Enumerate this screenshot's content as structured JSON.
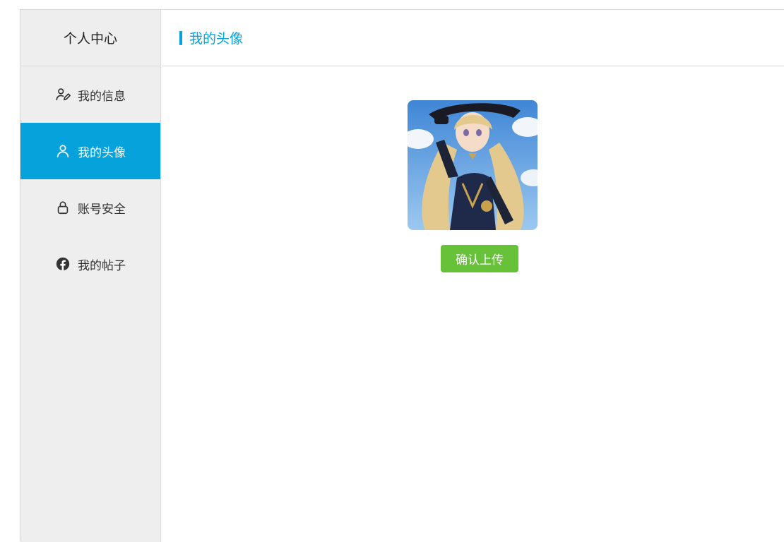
{
  "sidebar": {
    "title": "个人中心",
    "items": [
      {
        "label": "我的信息",
        "icon": "user-edit-icon",
        "active": false
      },
      {
        "label": "我的头像",
        "icon": "user-icon",
        "active": true
      },
      {
        "label": "账号安全",
        "icon": "lock-icon",
        "active": false
      },
      {
        "label": "我的帖子",
        "icon": "facebook-icon",
        "active": false
      }
    ]
  },
  "main": {
    "title": "我的头像",
    "upload_button_label": "确认上传",
    "avatar_alt": "avatar image"
  },
  "colors": {
    "accent": "#05a2dc",
    "button": "#67c23a",
    "sidebar_bg": "#eeeeee"
  }
}
